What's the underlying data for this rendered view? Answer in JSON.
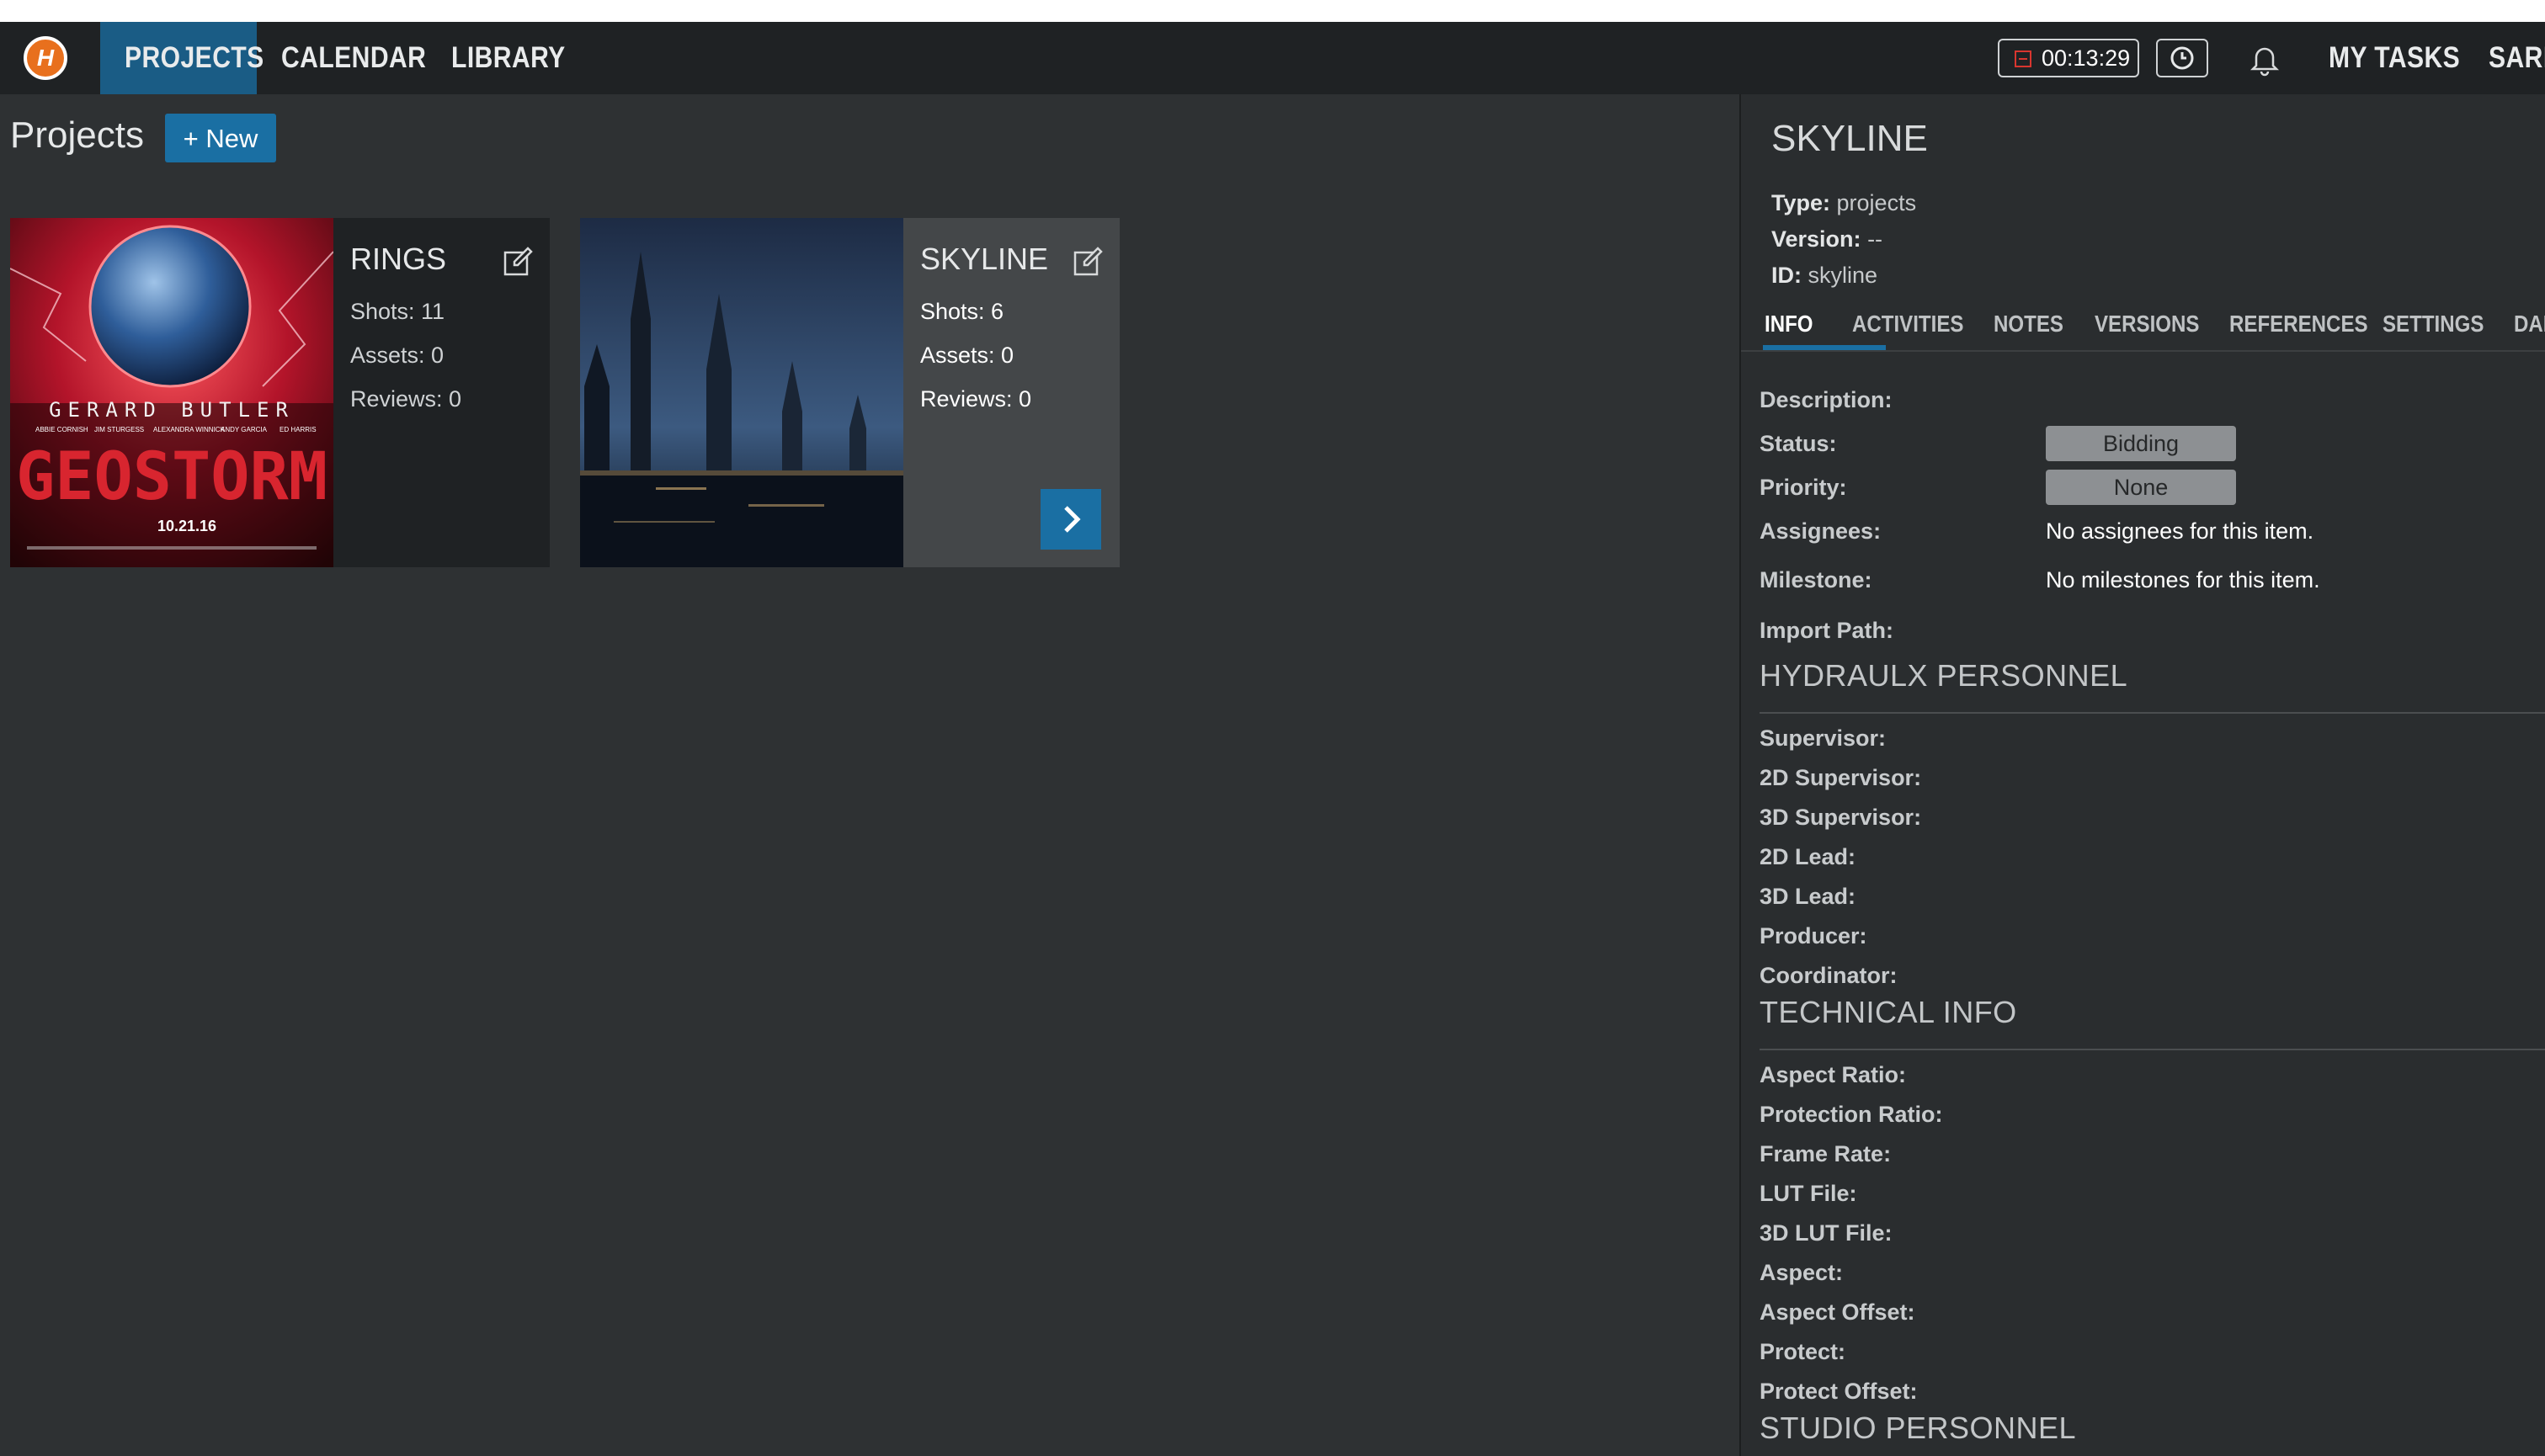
{
  "topnav": {
    "logo_letter": "H",
    "items": [
      "PROJECTS",
      "CALENDAR",
      "LIBRARY"
    ],
    "active_item": "PROJECTS",
    "timer": "00:13:29",
    "my_tasks": "MY TASKS",
    "user_partial": "SARI"
  },
  "projects": {
    "title": "Projects",
    "new_label": "+ New",
    "cards": [
      {
        "name": "RINGS",
        "shots": "Shots: 11",
        "assets": "Assets: 0",
        "reviews": "Reviews: 0",
        "poster": {
          "actor": "GERARD BUTLER",
          "costars": [
            "ABBIE CORNISH",
            "JIM STURGESS",
            "ALEXANDRA WINNICK",
            "ANDY GARCIA",
            "ED HARRIS"
          ],
          "film": "GEOSTORM",
          "date": "10.21.16"
        }
      },
      {
        "name": "SKYLINE",
        "shots": "Shots: 6",
        "assets": "Assets: 0",
        "reviews": "Reviews: 0"
      }
    ]
  },
  "panel": {
    "title": "SKYLINE",
    "type_label": "Type:",
    "type_value": "projects",
    "version_label": "Version:",
    "version_value": "--",
    "id_label": "ID:",
    "id_value": "skyline",
    "tabs": [
      "INFO",
      "ACTIVITIES",
      "NOTES",
      "VERSIONS",
      "REFERENCES",
      "SETTINGS",
      "DAI"
    ],
    "active_tab": "INFO",
    "info": {
      "description_label": "Description:",
      "status_label": "Status:",
      "status_value": "Bidding",
      "priority_label": "Priority:",
      "priority_value": "None",
      "assignees_label": "Assignees:",
      "assignees_value": "No assignees for this item.",
      "milestone_label": "Milestone:",
      "milestone_value": "No milestones for this item.",
      "import_path_label": "Import Path:"
    },
    "personnel_title": "HYDRAULX PERSONNEL",
    "personnel": [
      "Supervisor:",
      "2D Supervisor:",
      "3D Supervisor:",
      "2D Lead:",
      "3D Lead:",
      "Producer:",
      "Coordinator:"
    ],
    "technical_title": "TECHNICAL INFO",
    "technical": [
      "Aspect Ratio:",
      "Protection Ratio:",
      "Frame Rate:",
      "LUT File:",
      "3D LUT File:",
      "Aspect:",
      "Aspect Offset:",
      "Protect:",
      "Protect Offset:"
    ],
    "studio_title": "STUDIO PERSONNEL"
  },
  "colors": {
    "accent": "#1a6fa3",
    "nav_bg": "#1f2224",
    "page_bg": "#2e3133",
    "logo": "#e8701d"
  }
}
